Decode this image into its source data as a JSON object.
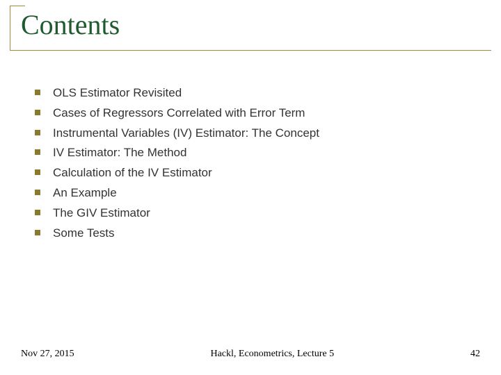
{
  "title": "Contents",
  "items": [
    "OLS Estimator Revisited",
    "Cases of Regressors Correlated with Error Term",
    "Instrumental Variables (IV) Estimator: The Concept",
    "IV Estimator: The Method",
    "Calculation of the IV Estimator",
    "An Example",
    "The GIV Estimator",
    "Some Tests"
  ],
  "footer": {
    "date": "Nov 27, 2015",
    "center": "Hackl,  Econometrics, Lecture 5",
    "page": "42"
  }
}
